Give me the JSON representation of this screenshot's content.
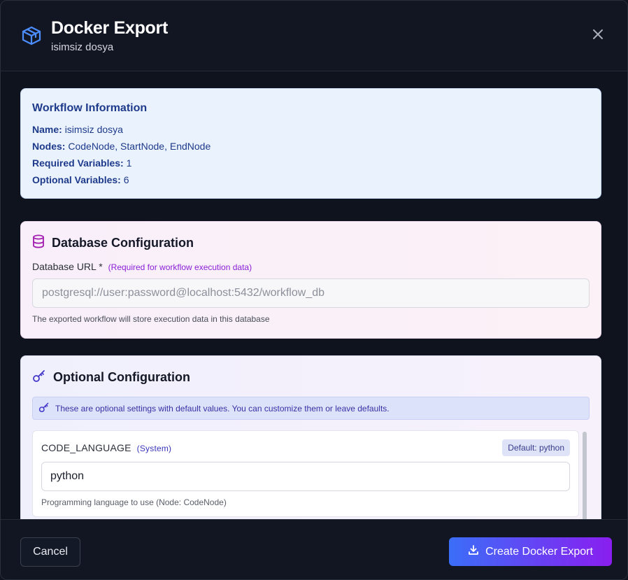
{
  "dialog": {
    "title": "Docker Export",
    "subtitle": "isimsiz dosya",
    "icon": "package-icon",
    "close_icon": "close-icon"
  },
  "workflow_info": {
    "title": "Workflow Information",
    "rows": [
      {
        "label": "Name:",
        "value": "isimsiz dosya"
      },
      {
        "label": "Nodes:",
        "value": "CodeNode, StartNode, EndNode"
      },
      {
        "label": "Required Variables:",
        "value": "1"
      },
      {
        "label": "Optional Variables:",
        "value": "6"
      }
    ]
  },
  "database": {
    "title": "Database Configuration",
    "icon": "database-icon",
    "field_label": "Database URL *",
    "required_hint": "(Required for workflow execution data)",
    "input_value": "",
    "input_placeholder": "postgresql://user:password@localhost:5432/workflow_db",
    "help": "The exported workflow will store execution data in this database"
  },
  "optional": {
    "title": "Optional Configuration",
    "icon": "key-icon",
    "notice": "These are optional settings with default values. You can customize them or leave defaults.",
    "variables": [
      {
        "name": "CODE_LANGUAGE",
        "tag": "(System)",
        "default": "Default: python",
        "value": "python",
        "help": "Programming language to use (Node: CodeNode)"
      }
    ]
  },
  "footer": {
    "cancel_label": "Cancel",
    "create_label": "Create Docker Export",
    "create_icon": "download-icon"
  },
  "colors": {
    "accent_start": "#3b6ef8",
    "accent_end": "#8a1ef0",
    "info_bg": "#eaf2fe",
    "info_text": "#1e3a8a",
    "required_hint": "#8b1fd6"
  }
}
